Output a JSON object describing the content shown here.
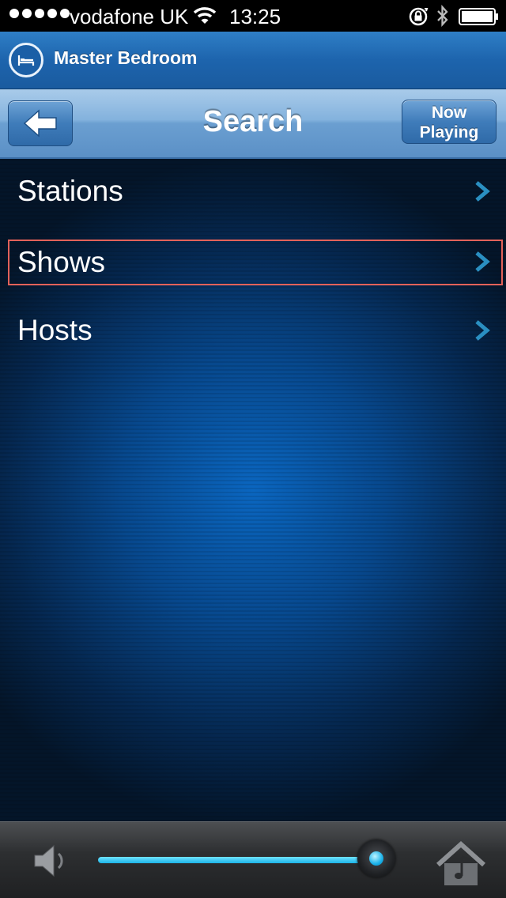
{
  "status_bar": {
    "carrier": "vodafone UK",
    "time": "13:25",
    "icons": [
      "signal-dots-icon",
      "wifi-icon",
      "rotation-lock-icon",
      "bluetooth-icon",
      "battery-icon"
    ]
  },
  "room_bar": {
    "title": "Master Bedroom",
    "icon": "bed-icon"
  },
  "nav_bar": {
    "title": "Search",
    "back_icon": "back-arrow-icon",
    "now_playing_line1": "Now",
    "now_playing_line2": "Playing"
  },
  "list": {
    "items": [
      {
        "label": "Stations"
      },
      {
        "label": "Shows",
        "highlighted": true
      },
      {
        "label": "Hosts"
      }
    ]
  },
  "bottom_bar": {
    "volume_icon": "speaker-icon",
    "volume_level": 0.95,
    "home_icon": "music-home-icon"
  },
  "colors": {
    "accent_blue": "#1d64ad",
    "highlight_frame": "#e3625a",
    "volume_fill": "#1cb5e8"
  }
}
